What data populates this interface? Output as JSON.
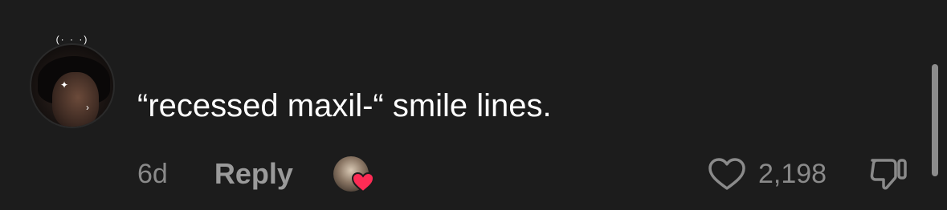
{
  "comment": {
    "avatar_caption": "(· ·  ·)",
    "text": "“recessed maxil-“ smile lines.",
    "time": "6d",
    "reply_label": "Reply",
    "creator_liked": true,
    "like_count": "2,198"
  },
  "icons": {
    "like": "heart-outline-icon",
    "creator_heart": "heart-filled-icon",
    "dislike": "thumbs-down-icon"
  },
  "colors": {
    "background": "#1c1c1c",
    "text_primary": "#ffffff",
    "text_secondary": "#8a8a8a",
    "creator_heart": "#fe2c55"
  }
}
